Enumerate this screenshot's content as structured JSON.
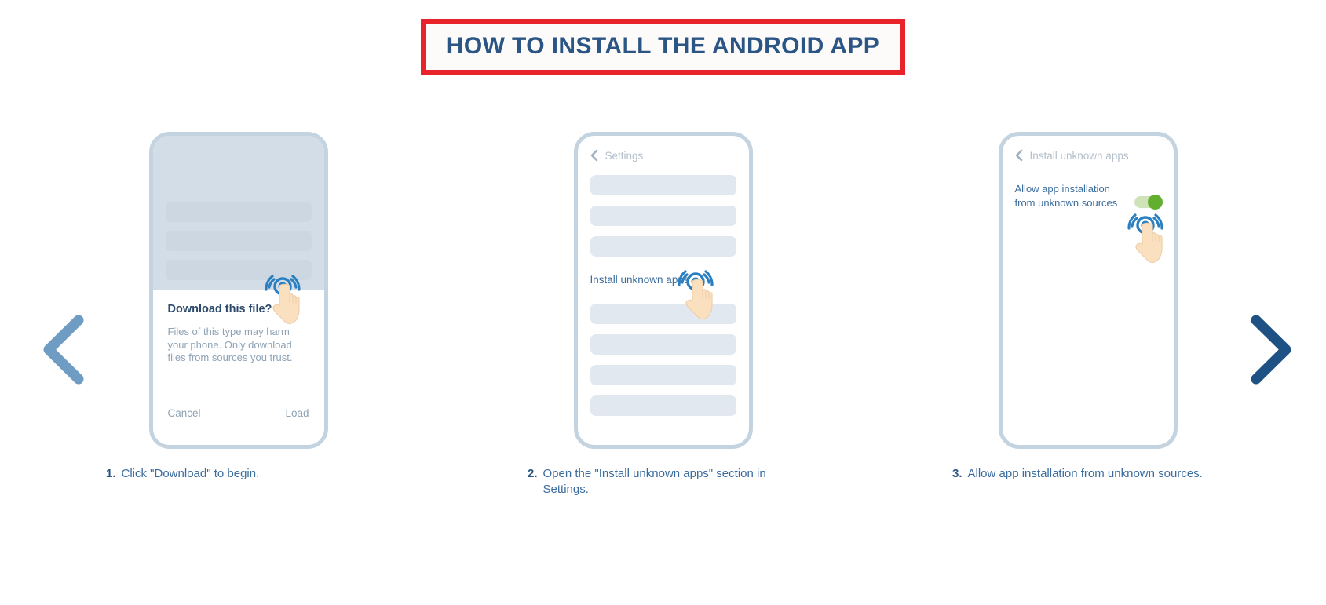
{
  "header": {
    "title": "HOW TO INSTALL THE ANDROID APP",
    "title_color": "#2b5584",
    "border_color": "#e8232a"
  },
  "carousel": {
    "prev_icon": "chevron-left-icon",
    "next_icon": "chevron-right-icon",
    "prev_color": "#6e9cc2",
    "next_color": "#1e5184"
  },
  "steps": [
    {
      "number": "1.",
      "caption": "Click \"Download\" to begin.",
      "phone": {
        "type": "download-dialog",
        "dialog_title": "Download this file?",
        "dialog_body": "Files of this type may harm your phone. Only download files from sources you trust.",
        "cancel_label": "Cancel",
        "confirm_label": "Load",
        "tap_icon": "tap-hand-icon"
      }
    },
    {
      "number": "2.",
      "caption": "Open the \"Install unknown apps\" section in Settings.",
      "phone": {
        "type": "settings-list",
        "back_icon": "chevron-left-icon",
        "header_label": "Settings",
        "link_label": "Install unknown apps",
        "tap_icon": "tap-hand-icon"
      }
    },
    {
      "number": "3.",
      "caption": "Allow app installation from unknown sources.",
      "phone": {
        "type": "permission-toggle",
        "back_icon": "chevron-left-icon",
        "header_label": "Install unknown apps",
        "setting_label": "Allow app installation from unknown sources",
        "toggle_state": "on",
        "toggle_on_color": "#62af2f",
        "tap_icon": "tap-hand-icon"
      }
    }
  ]
}
